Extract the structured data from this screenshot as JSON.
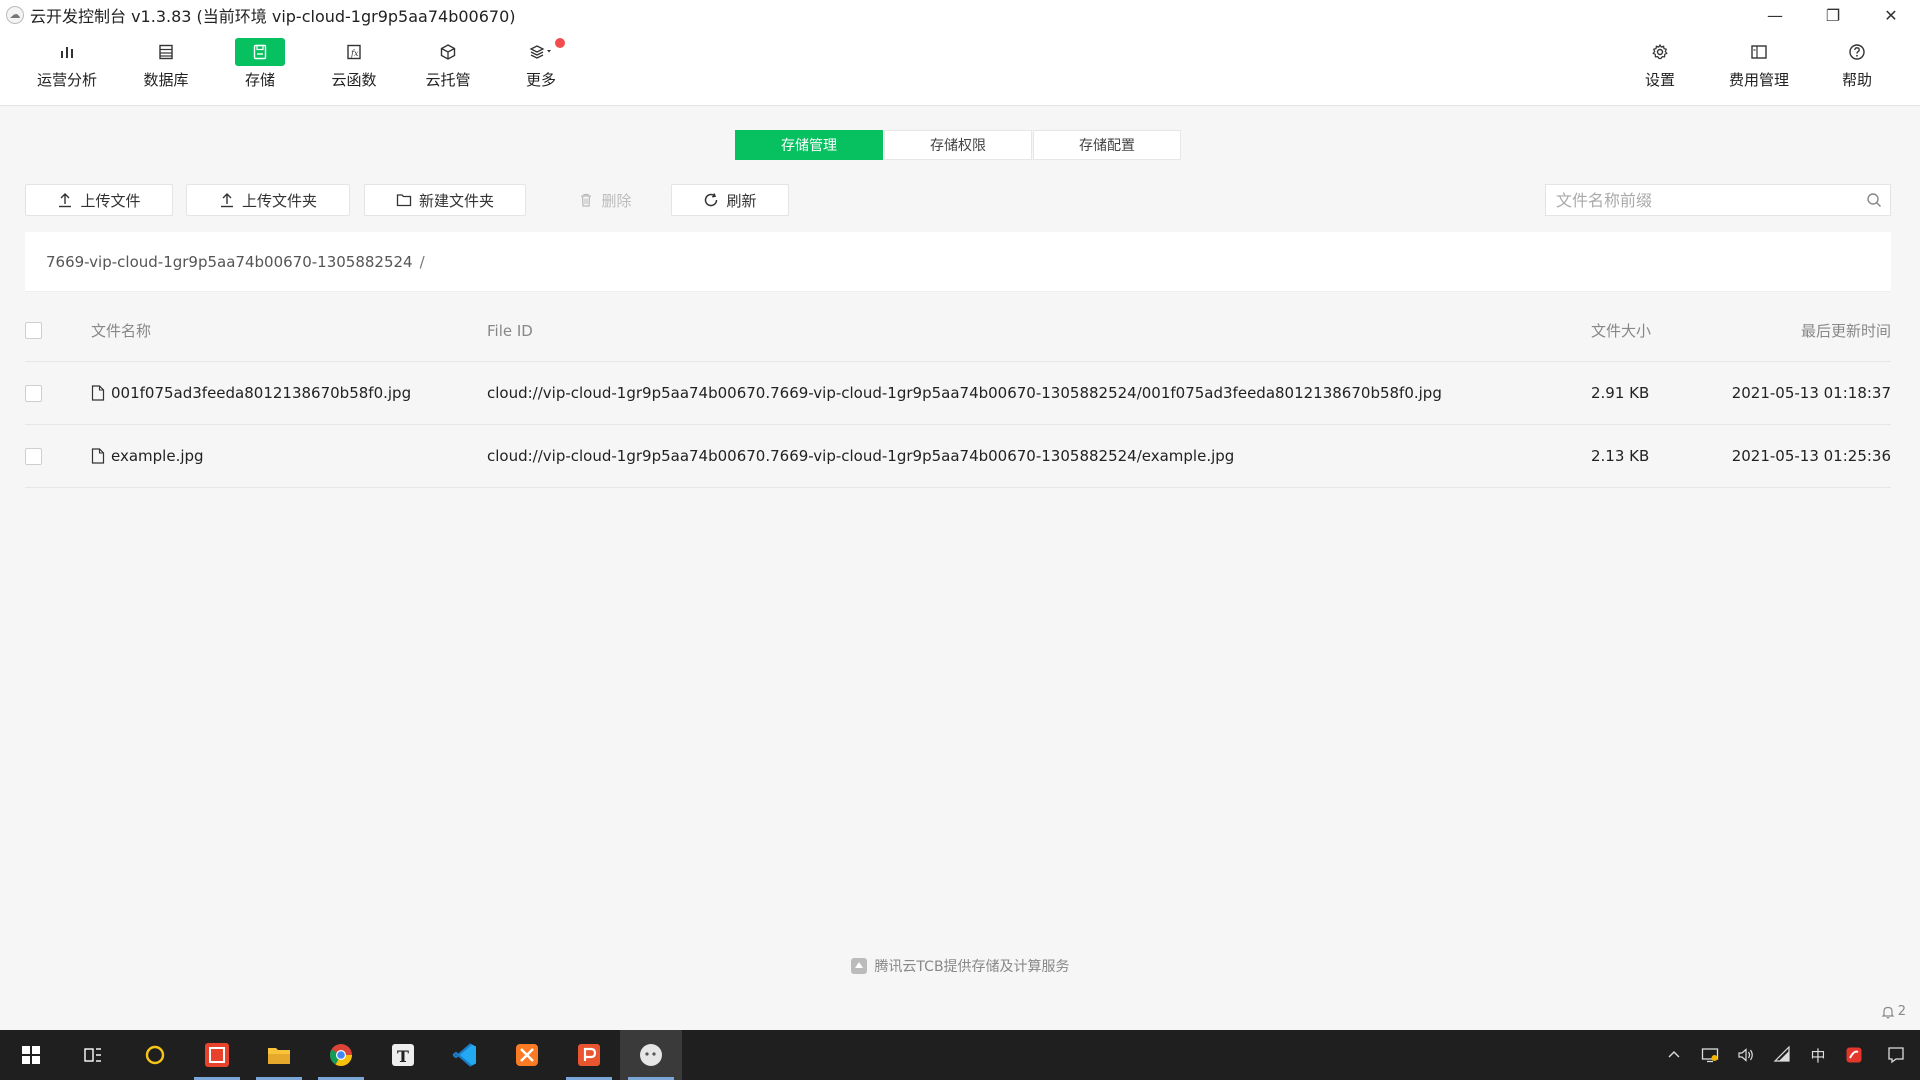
{
  "window": {
    "title": "云开发控制台 v1.3.83  (当前环境 vip-cloud-1gr9p5aa74b00670)",
    "controls": [
      "—",
      "❐",
      "✕"
    ]
  },
  "toolbar": {
    "left": [
      {
        "label": "运营分析",
        "icon": "bar-chart-icon",
        "active": false
      },
      {
        "label": "数据库",
        "icon": "database-icon",
        "active": false
      },
      {
        "label": "存储",
        "icon": "storage-icon",
        "active": true
      },
      {
        "label": "云函数",
        "icon": "function-icon",
        "active": false
      },
      {
        "label": "云托管",
        "icon": "cube-icon",
        "active": false
      },
      {
        "label": "更多",
        "icon": "layers-icon",
        "active": false,
        "badge": true
      }
    ],
    "right": [
      {
        "label": "设置",
        "icon": "gear-icon"
      },
      {
        "label": "费用管理",
        "icon": "billing-icon"
      },
      {
        "label": "帮助",
        "icon": "help-icon"
      }
    ]
  },
  "tabs": [
    {
      "label": "存储管理",
      "active": true
    },
    {
      "label": "存储权限",
      "active": false
    },
    {
      "label": "存储配置",
      "active": false
    }
  ],
  "actions": {
    "upload_file": "上传文件",
    "upload_folder": "上传文件夹",
    "new_folder": "新建文件夹",
    "delete": "删除",
    "refresh": "刷新"
  },
  "search": {
    "placeholder": "文件名称前缀",
    "value": ""
  },
  "breadcrumb": {
    "path": "7669-vip-cloud-1gr9p5aa74b00670-1305882524",
    "separator": "/"
  },
  "table": {
    "columns": {
      "name": "文件名称",
      "file_id": "File ID",
      "size": "文件大小",
      "updated": "最后更新时间"
    },
    "rows": [
      {
        "name": "001f075ad3feeda8012138670b58f0.jpg",
        "file_id": "cloud://vip-cloud-1gr9p5aa74b00670.7669-vip-cloud-1gr9p5aa74b00670-1305882524/001f075ad3feeda8012138670b58f0.jpg",
        "size": "2.91 KB",
        "updated": "2021-05-13 01:18:37"
      },
      {
        "name": "example.jpg",
        "file_id": "cloud://vip-cloud-1gr9p5aa74b00670.7669-vip-cloud-1gr9p5aa74b00670-1305882524/example.jpg",
        "size": "2.13 KB",
        "updated": "2021-05-13 01:25:36"
      }
    ]
  },
  "footer": {
    "note": "腾讯云TCB提供存储及计算服务",
    "notification_count": "2"
  },
  "colors": {
    "accent": "#07c160",
    "badge": "#f24c4c",
    "taskbar": "#1f1f1f"
  },
  "taskbar": {
    "apps": [
      "windows-start-icon",
      "task-view-icon",
      "cortana-icon",
      "ide-icon",
      "file-explorer-icon",
      "chrome-icon",
      "typora-icon",
      "vscode-icon",
      "xampp-icon",
      "powerpoint-icon",
      "wechat-devtools-icon"
    ],
    "tray": [
      "chevron-up-icon",
      "network-monitor-icon",
      "volume-icon",
      "wifi-icon",
      "中",
      "antivirus-icon",
      "notification-icon"
    ],
    "ime": "中"
  }
}
